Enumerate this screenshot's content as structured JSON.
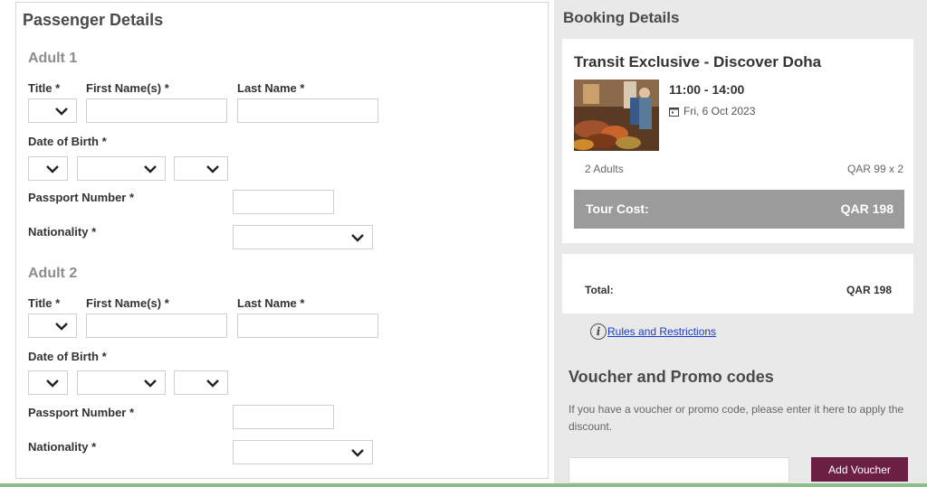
{
  "passenger_details": {
    "title": "Passenger Details",
    "adults": [
      {
        "heading": "Adult 1",
        "title_label": "Title *",
        "first_name_label": "First Name(s) *",
        "last_name_label": "Last Name *",
        "dob_label": "Date of Birth *",
        "passport_label": "Passport Number *",
        "nationality_label": "Nationality *"
      },
      {
        "heading": "Adult 2",
        "title_label": "Title *",
        "first_name_label": "First Name(s) *",
        "last_name_label": "Last Name *",
        "dob_label": "Date of Birth *",
        "passport_label": "Passport Number *",
        "nationality_label": "Nationality *"
      }
    ]
  },
  "booking": {
    "title": "Booking Details",
    "tour_name": "Transit Exclusive - Discover Doha",
    "time": "11:00 - 14:00",
    "date": "Fri, 6 Oct 2023",
    "adults": "2 Adults",
    "price_each": "QAR 99 x 2",
    "tour_cost_label": "Tour Cost:",
    "tour_cost_value": "QAR 198",
    "total_label": "Total:",
    "total_value": "QAR 198",
    "rules_link": "Rules and Restrictions"
  },
  "voucher": {
    "title": "Voucher and Promo codes",
    "help": "If you have a voucher or promo code, please enter it here to apply the discount.",
    "button_label": "Add Voucher"
  },
  "colors": {
    "voucher_button": "#6b1f42",
    "cost_bar": "#9b9b9b",
    "sidebar_bg": "#e9e9e9",
    "link": "#1a3cc8"
  }
}
